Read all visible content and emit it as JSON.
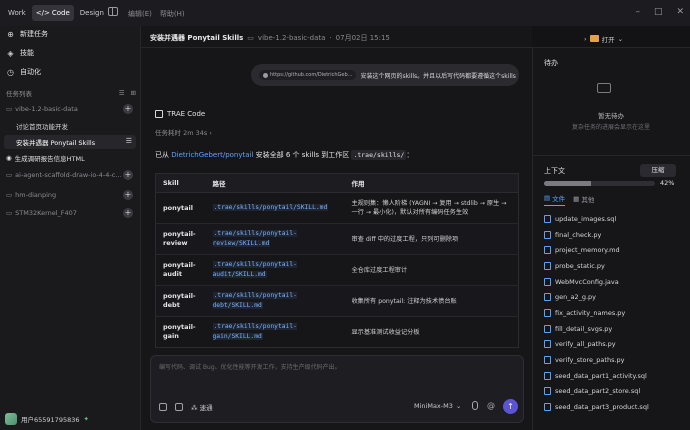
{
  "topbar": {
    "modes": [
      {
        "label": "Work",
        "icon": ""
      },
      {
        "label": "Code",
        "icon": "</>"
      },
      {
        "label": "Design",
        "icon": ""
      }
    ],
    "menu": [
      "编辑(E)",
      "帮助(H)"
    ]
  },
  "sidebar": {
    "nav": [
      {
        "label": "新建任务",
        "icon": "plus-square-icon",
        "glyph": "⊕"
      },
      {
        "label": "技能",
        "icon": "skills-icon",
        "glyph": "◈"
      },
      {
        "label": "自动化",
        "icon": "automation-icon",
        "glyph": "◷"
      }
    ],
    "tasks_label": "任务列表",
    "tasks": [
      {
        "label": "vibe-1.2-basic-data",
        "kind": "group",
        "plus": true
      },
      {
        "label": "讨论首页功能开发",
        "kind": "sub"
      },
      {
        "label": "安装并遇器 Ponytail Skills",
        "kind": "sub",
        "selected": true
      },
      {
        "label": "生成调研报告信息HTML",
        "kind": "task"
      },
      {
        "label": "ai-agent-scaffold-draw-io-4-4-ch...",
        "kind": "group",
        "plus": true
      },
      {
        "label": "hm-dianping",
        "kind": "group",
        "plus": true
      },
      {
        "label": "STM32Kernel_F407",
        "kind": "group",
        "plus": true
      }
    ],
    "user": "用户65591795836"
  },
  "header": {
    "title": "安装并遇器 Ponytail Skills",
    "project": "vibe-1.2-basic-data",
    "date": "07月02日 15:15",
    "open_in": "打开"
  },
  "chat": {
    "user_message": {
      "link": "https://github.com/DietrichGeb...",
      "text": "安装这个网页的skills。并且以后写代码都要遵循这个skills"
    },
    "agent_name": "TRAE Code",
    "elapsed": "任务耗时 2m 34s",
    "summary_prefix": "已从",
    "summary_link": "DietrichGebert/ponytail",
    "summary_mid": "安装全部 6 个 skills 到工作区",
    "summary_code": ".trae/skills/",
    "summary_end": "：",
    "table": {
      "headers": [
        "Skill",
        "路径",
        "作用"
      ],
      "rows": [
        {
          "skill": "ponytail",
          "path": ".trae/skills/ponytail/SKILL.md",
          "desc": "主规则集：懒人阶梯 (YAGNI → 复用 → stdlib → 原生 → 一行 → 最小化)，默认对所有编码任务生效"
        },
        {
          "skill": "ponytail-review",
          "path": ".trae/skills/ponytail-review/SKILL.md",
          "desc": "审查 diff 中的过度工程，只列可删除项"
        },
        {
          "skill": "ponytail-audit",
          "path": ".trae/skills/ponytail-audit/SKILL.md",
          "desc": "全仓库过度工程审计"
        },
        {
          "skill": "ponytail-debt",
          "path": ".trae/skills/ponytail-debt/SKILL.md",
          "desc": "收集所有 ponytail: 注释为技术债台账"
        },
        {
          "skill": "ponytail-gain",
          "path": ".trae/skills/ponytail-gain/SKILL.md",
          "desc": "显示基准测试收益记分板"
        }
      ]
    }
  },
  "composer": {
    "placeholder": "编写代码、调试 Bug、优化性能等开发工作，支持生产级代码产出。",
    "fast_label": "速通",
    "model": "MiniMax-M3"
  },
  "right_panel": {
    "todo_title": "待办",
    "todo_empty_title": "暂无待办",
    "todo_empty_desc": "复杂任务的进展会显示在这里",
    "context_title": "上下文",
    "compact_label": "压缩",
    "context_pct": "42%",
    "context_fraction": 0.42,
    "tabs": [
      "文件",
      "其他"
    ],
    "files": [
      "update_images.sql",
      "final_check.py",
      "project_memory.md",
      "probe_static.py",
      "WebMvcConfig.java",
      "gen_a2_g.py",
      "fix_activity_names.py",
      "fill_detail_svgs.py",
      "verify_all_paths.py",
      "verify_store_paths.py",
      "seed_data_part1_activity.sql",
      "seed_data_part2_store.sql",
      "seed_data_part3_product.sql"
    ]
  }
}
